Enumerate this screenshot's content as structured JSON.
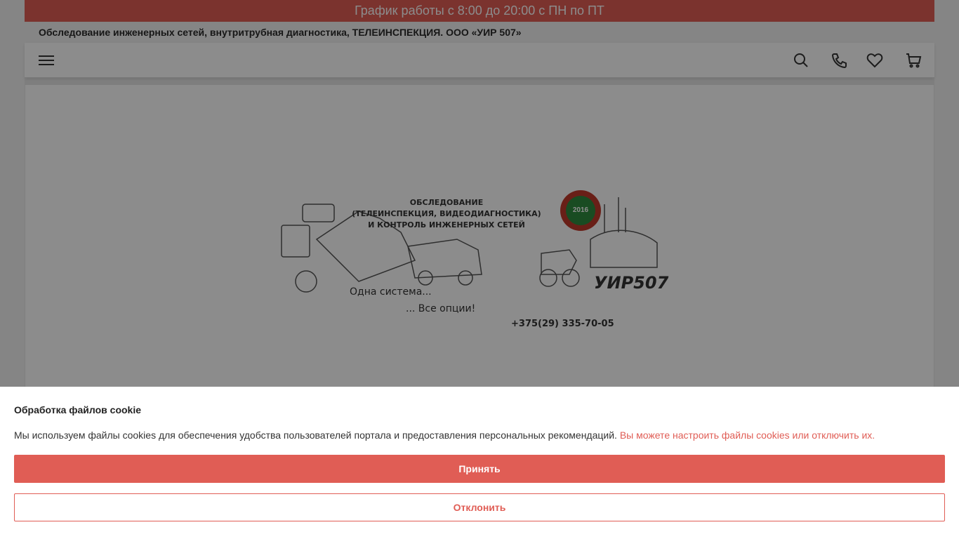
{
  "header": {
    "schedule": "График работы с 8:00 до 20:00 с ПН по ПТ",
    "subtitle": "Обследование инженерных сетей, внутритрубная диагностика, ТЕЛЕИНСПЕКЦИЯ. ООО «УИР 507»"
  },
  "nav": {
    "icons": [
      "menu-icon",
      "search-icon",
      "phone-icon",
      "heart-icon",
      "cart-icon"
    ]
  },
  "hero": {
    "heading_line1": "ОБСЛЕДОВАНИЕ",
    "heading_line2": "(ТЕЛЕИНСПЕКЦИЯ, ВИДЕОДИАГНОСТИКА)",
    "heading_line3": "И КОНТРОЛЬ ИНЖЕНЕРНЫХ СЕТЕЙ",
    "slogan1": "Одна система...",
    "slogan2": "... Все опции!",
    "phone": "+375(29) 335-70-05",
    "badge_year": "2016",
    "logo": "УИР507"
  },
  "cookie": {
    "title": "Обработка файлов cookie",
    "text": "Мы используем файлы cookies для обеспечения удобства пользователей портала и предоставления персональных рекомендаций.",
    "link": "Вы можете настроить файлы cookies или отключить их.",
    "accept": "Принять",
    "decline": "Отклонить"
  },
  "colors": {
    "accent": "#e05d55",
    "overlay": "rgba(0,0,0,0.45)"
  }
}
